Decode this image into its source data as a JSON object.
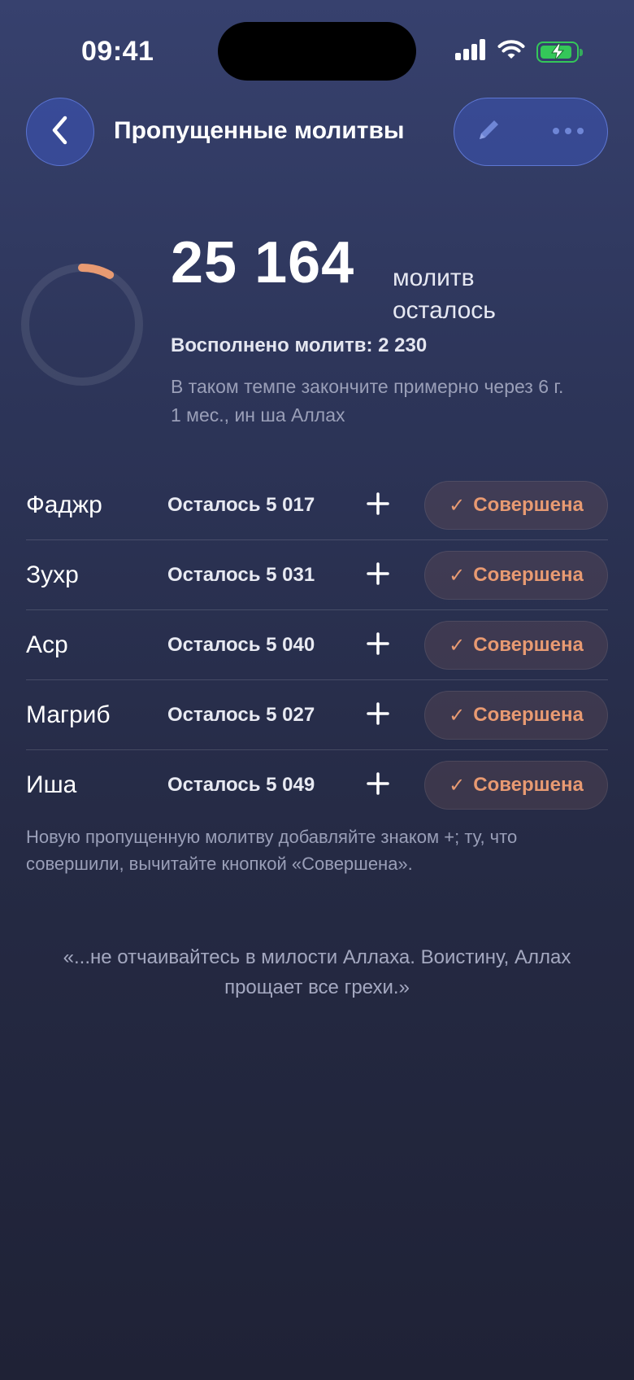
{
  "status_bar": {
    "time": "09:41"
  },
  "nav": {
    "title": "Пропущенные молитвы"
  },
  "summary": {
    "remaining_number": "25 164",
    "remaining_unit": "молитв осталось",
    "completed_text": "Восполнено молитв: 2 230",
    "forecast_text": "В таком темпе закончите примерно через 6 г. 1 мес., ин ша Аллах",
    "progress_fraction": 0.081
  },
  "prayers": [
    {
      "name": "Фаджр",
      "remaining": "Осталось 5 017",
      "done_label": "Совершена"
    },
    {
      "name": "Зухр",
      "remaining": "Осталось 5 031",
      "done_label": "Совершена"
    },
    {
      "name": "Аср",
      "remaining": "Осталось 5 040",
      "done_label": "Совершена"
    },
    {
      "name": "Магриб",
      "remaining": "Осталось 5 027",
      "done_label": "Совершена"
    },
    {
      "name": "Иша",
      "remaining": "Осталось 5 049",
      "done_label": "Совершена"
    }
  ],
  "hint": "Новую пропущенную молитву добавляйте знаком +; ту, что совершили, вычитайте кнопкой «Совершена».",
  "quote": "«...не отчаивайтесь в милости Аллаха. Воистину, Аллах прощает все грехи.»",
  "icons": {
    "back": "chevron-left-icon",
    "edit": "pencil-icon",
    "more": "more-dots-icon",
    "add": "plus-icon",
    "done": "checkmark-icon"
  },
  "colors": {
    "accent": "#e89a72",
    "battery": "#34c759",
    "nav_button": "#3c55be"
  }
}
